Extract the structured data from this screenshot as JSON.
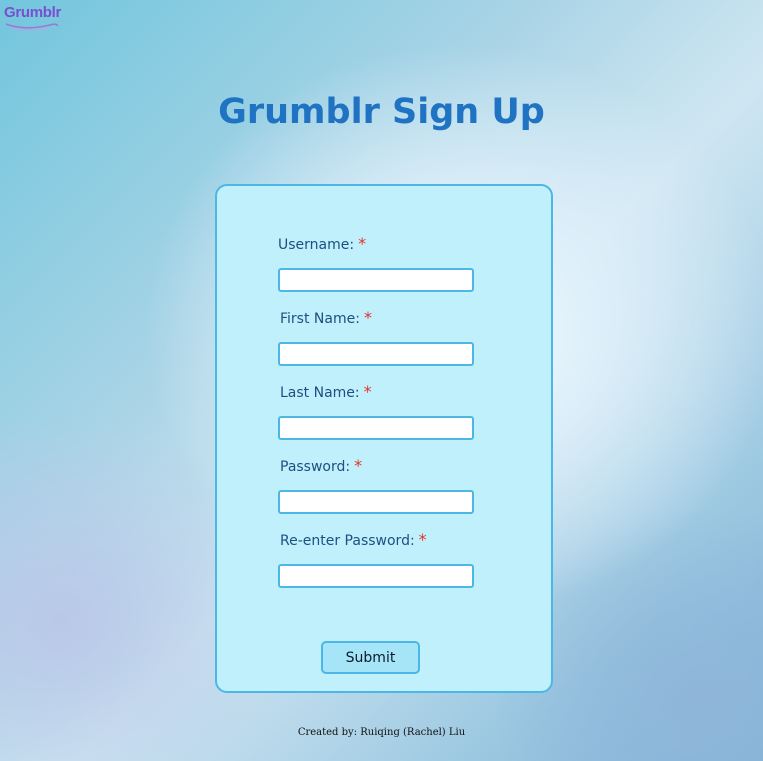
{
  "app": {
    "logo_text": "Grumblr"
  },
  "page": {
    "title": "Grumblr Sign Up"
  },
  "form": {
    "required_mark": "*",
    "fields": [
      {
        "label": "Username:",
        "value": ""
      },
      {
        "label": "First Name:",
        "value": ""
      },
      {
        "label": "Last Name:",
        "value": ""
      },
      {
        "label": "Password:",
        "value": ""
      },
      {
        "label": "Re-enter Password:",
        "value": ""
      }
    ],
    "submit_label": "Submit"
  },
  "footer": {
    "credit": "Created by: Ruiqing (Rachel) Liu"
  },
  "colors": {
    "title": "#1f73c2",
    "card_background": "#bff0fc",
    "card_border": "#4cb7e4",
    "required": "#e8302a",
    "logo": "#7a4fcf"
  }
}
